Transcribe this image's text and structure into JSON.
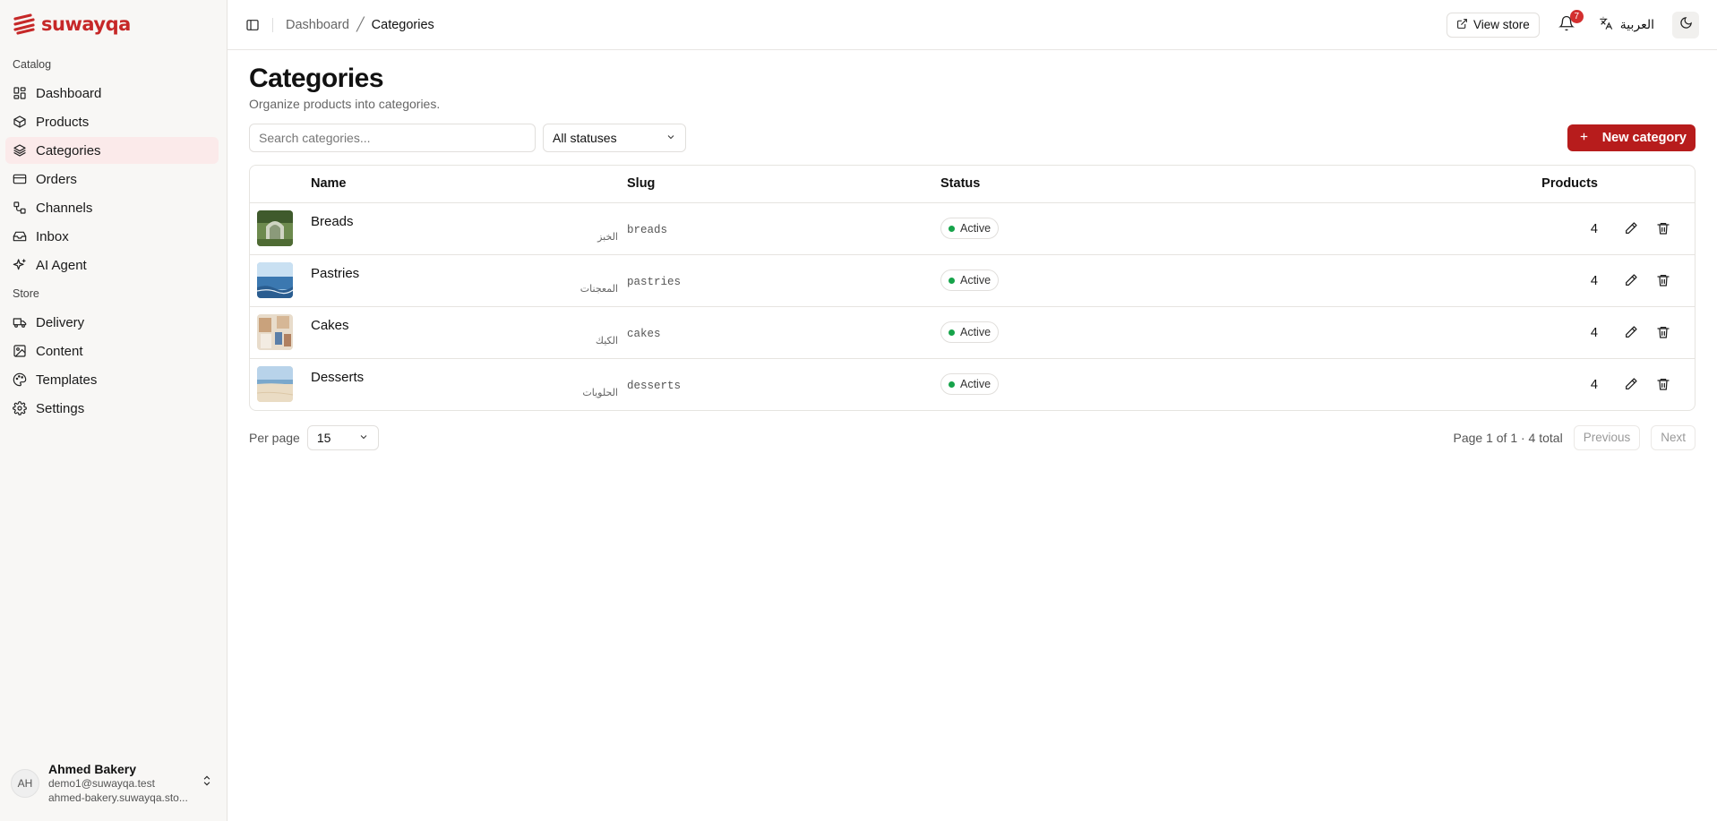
{
  "brand": {
    "name": "suwayqa",
    "color": "#c62828"
  },
  "sidebar": {
    "sections": [
      {
        "label": "Catalog"
      },
      {
        "label": "Store"
      }
    ],
    "catalog_items": [
      {
        "label": "Dashboard",
        "icon": "dashboard-icon"
      },
      {
        "label": "Products",
        "icon": "package-icon"
      },
      {
        "label": "Categories",
        "icon": "layers-icon",
        "active": true
      },
      {
        "label": "Orders",
        "icon": "credit-card-icon"
      },
      {
        "label": "Channels",
        "icon": "workflow-icon"
      },
      {
        "label": "Inbox",
        "icon": "inbox-icon"
      },
      {
        "label": "AI Agent",
        "icon": "sparkles-icon"
      }
    ],
    "store_items": [
      {
        "label": "Delivery",
        "icon": "truck-icon"
      },
      {
        "label": "Content",
        "icon": "image-icon"
      },
      {
        "label": "Templates",
        "icon": "palette-icon"
      },
      {
        "label": "Settings",
        "icon": "gear-icon"
      }
    ],
    "user": {
      "initials": "AH",
      "name": "Ahmed Bakery",
      "email": "demo1@suwayqa.test",
      "domain": "ahmed-bakery.suwayqa.sto..."
    }
  },
  "topbar": {
    "breadcrumb": [
      "Dashboard",
      "Categories"
    ],
    "view_store": "View store",
    "notifications_count": "7",
    "language": "العربية"
  },
  "page": {
    "title": "Categories",
    "subtitle": "Organize products into categories.",
    "search_placeholder": "Search categories...",
    "status_filter": "All statuses",
    "new_button": "New category"
  },
  "table": {
    "columns": [
      "Name",
      "Slug",
      "Status",
      "Products"
    ],
    "rows": [
      {
        "name": "Breads",
        "name_ar": "الخبز",
        "slug": "breads",
        "status": "Active",
        "products": "4",
        "thumb": "garden"
      },
      {
        "name": "Pastries",
        "name_ar": "المعجنات",
        "slug": "pastries",
        "status": "Active",
        "products": "4",
        "thumb": "sea"
      },
      {
        "name": "Cakes",
        "name_ar": "الكيك",
        "slug": "cakes",
        "status": "Active",
        "products": "4",
        "thumb": "kitchen"
      },
      {
        "name": "Desserts",
        "name_ar": "الحلويات",
        "slug": "desserts",
        "status": "Active",
        "products": "4",
        "thumb": "beach"
      }
    ]
  },
  "pagination": {
    "per_page_label": "Per page",
    "per_page_value": "15",
    "summary": "Page 1 of 1 · 4 total",
    "previous": "Previous",
    "next": "Next"
  }
}
